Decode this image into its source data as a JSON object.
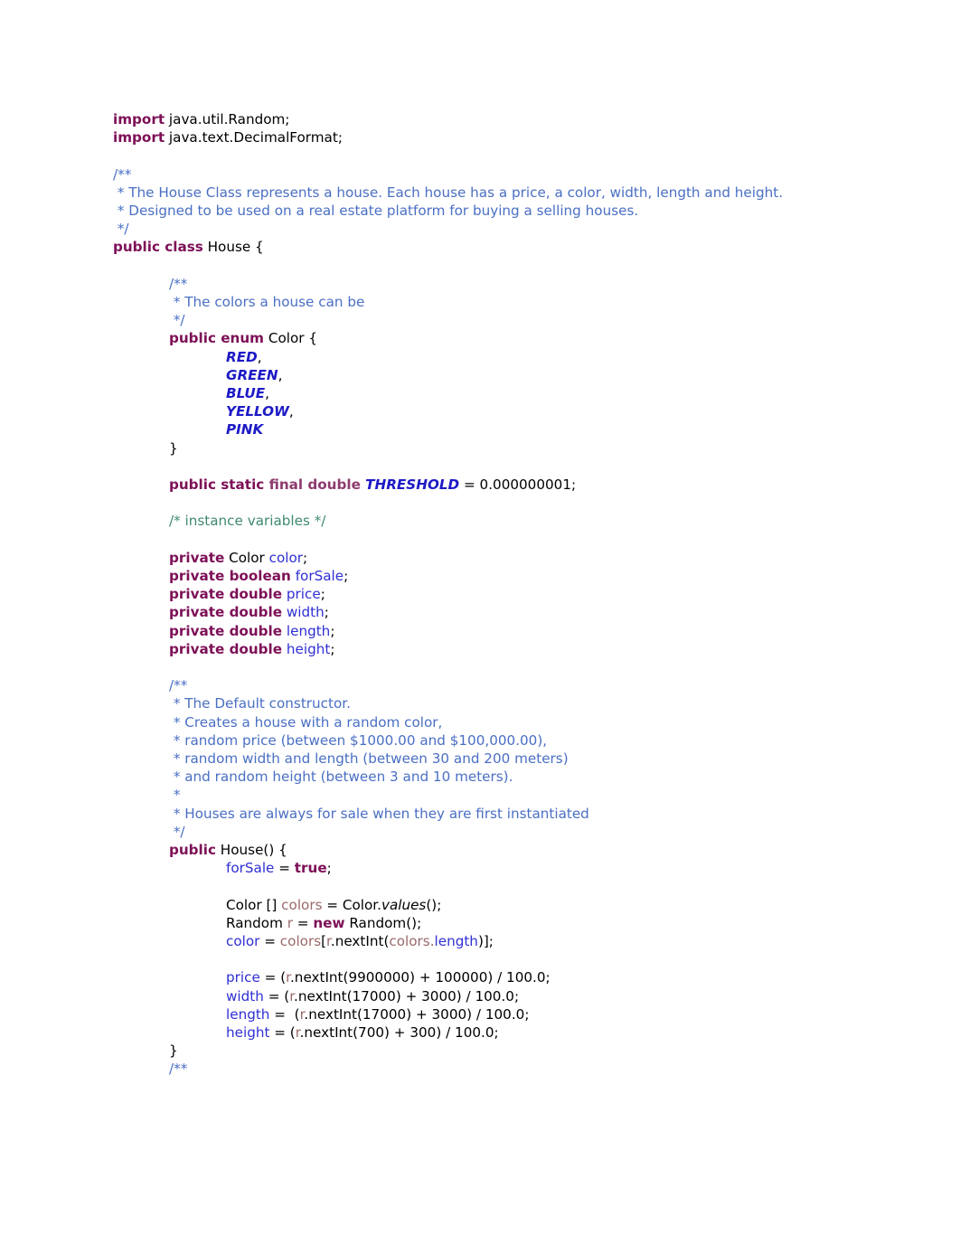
{
  "document": {
    "type": "java-source-listing",
    "class_name": "House",
    "colors": {
      "keyword": "#7d1057",
      "javadoc": "#4a6fc4",
      "block_comment": "#3f8a6e",
      "enum_constant": "#1d1ac6",
      "field": "#2f2fd4",
      "local_variable": "#9b6a6a",
      "plain": "#000000",
      "background": "#ffffff"
    }
  },
  "code": {
    "imports": [
      {
        "keyword": "import",
        "rest": " java.util.Random;"
      },
      {
        "keyword": "import",
        "rest": " java.text.DecimalFormat;"
      }
    ],
    "class_javadoc": [
      "/**",
      " * The House Class represents a house. Each house has a price, a color, width, length and height.",
      " * Designed to be used on a real estate platform for buying a selling houses.",
      " */"
    ],
    "class_decl": {
      "keyword": "public class",
      "rest": " House {"
    },
    "enum_javadoc": [
      "/**",
      " * The colors a house can be",
      " */"
    ],
    "enum_decl": {
      "keyword": "public enum",
      "rest": " Color {"
    },
    "enum_constants": [
      {
        "name": "RED",
        "comma": ","
      },
      {
        "name": "GREEN",
        "comma": ","
      },
      {
        "name": "BLUE",
        "comma": ","
      },
      {
        "name": "YELLOW",
        "comma": ","
      },
      {
        "name": "PINK",
        "comma": ""
      }
    ],
    "enum_close": "}",
    "threshold": {
      "mod_a": "public static ",
      "mod_b": "final double ",
      "name": "THRESHOLD",
      "tail": " = 0.000000001;"
    },
    "instance_var_comment": "/* instance variables */",
    "fields": [
      {
        "keyword": "private",
        "type": " Color ",
        "name": "color",
        "semi": ";",
        "type_bold": false
      },
      {
        "keyword": "private boolean",
        "type": " ",
        "name": "forSale",
        "semi": ";",
        "type_bold": true
      },
      {
        "keyword": "private double",
        "type": " ",
        "name": "price",
        "semi": ";",
        "type_bold": true
      },
      {
        "keyword": "private double",
        "type": " ",
        "name": "width",
        "semi": ";",
        "type_bold": true
      },
      {
        "keyword": "private double",
        "type": " ",
        "name": "length",
        "semi": ";",
        "type_bold": true
      },
      {
        "keyword": "private double",
        "type": " ",
        "name": "height",
        "semi": ";",
        "type_bold": true
      }
    ],
    "ctor_javadoc": [
      "/**",
      " * The Default constructor.",
      " * Creates a house with a random color,",
      " * random price (between $1000.00 and $100,000.00),",
      " * random width and length (between 30 and 200 meters)",
      " * and random height (between 3 and 10 meters).",
      " *",
      " * Houses are always for sale when they are first instantiated",
      " */"
    ],
    "ctor_decl": {
      "keyword": "public",
      "rest": " House() {"
    },
    "ctor_body": {
      "for_sale_field": "forSale",
      "for_sale_eq": " = ",
      "for_sale_true": "true",
      "for_sale_semi": ";",
      "colors_decl_pre": "Color [] ",
      "colors_decl_var": "colors",
      "colors_decl_mid": " = Color.",
      "colors_decl_meth": "values",
      "colors_decl_post": "();",
      "random_pre": "Random ",
      "random_var": "r",
      "random_mid": " = ",
      "random_kw": "new",
      "random_post": " Random();",
      "color_assign_field": "color",
      "color_assign_mid": " = ",
      "color_assign_var": "colors",
      "color_assign_brk": "[",
      "color_assign_r": "r",
      "color_assign_next": ".nextInt(",
      "color_assign_var2": "colors",
      "color_assign_dot": ".",
      "color_assign_length": "length",
      "color_assign_end": ")];",
      "assignments": [
        {
          "field": "price",
          "eq": " = (",
          "var": "r",
          "expr": ".nextInt(9900000) + 100000) / 100.0;"
        },
        {
          "field": "width",
          "eq": " = (",
          "var": "r",
          "expr": ".nextInt(17000) + 3000) / 100.0;"
        },
        {
          "field": "length",
          "eq": " =  (",
          "var": "r",
          "expr": ".nextInt(17000) + 3000) / 100.0;"
        },
        {
          "field": "height",
          "eq": " = (",
          "var": "r",
          "expr": ".nextInt(700) + 300) / 100.0;"
        }
      ]
    },
    "ctor_close": "}",
    "trailing_javadoc_open": "/**"
  }
}
